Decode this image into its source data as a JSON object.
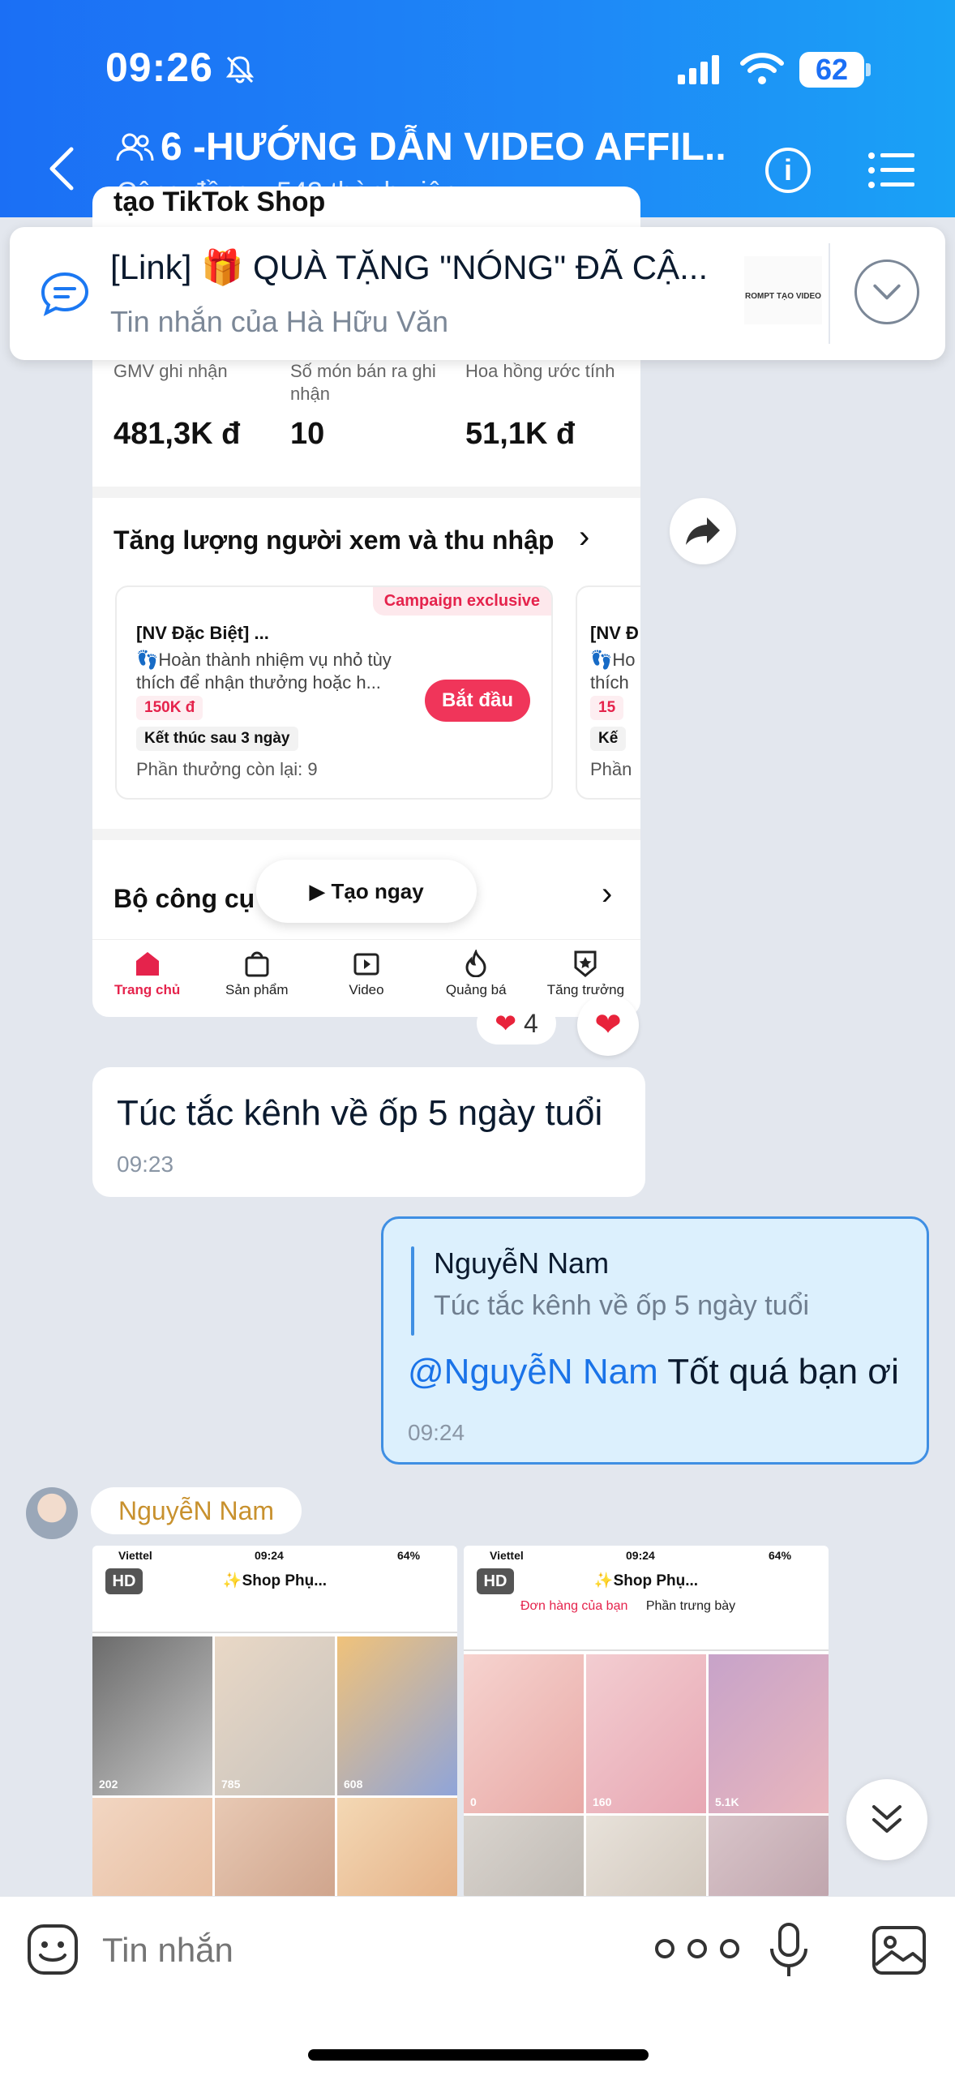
{
  "status_bar": {
    "time": "09:26",
    "battery": "62"
  },
  "header": {
    "title": "6 -HƯỚNG DẪN VIDEO AFFIL...",
    "subtitle": "Cộng đồng • 543 thành viên"
  },
  "pinned": {
    "title": "[Link] 🎁 QUÀ TẶNG \"NÓNG\" ĐÃ CẬ...",
    "from": "Tin nhắn của Hà Hữu Văn",
    "thumb_label": "ROMPT TẠO VIDEO"
  },
  "shop_screenshot": {
    "top_text": "tạo TikTok Shop",
    "stats": [
      {
        "label": "GMV ghi nhận",
        "value": "481,3K đ"
      },
      {
        "label": "Số món bán ra ghi nhận",
        "value": "10"
      },
      {
        "label": "Hoa hồng ước tính",
        "value": "51,1K đ"
      }
    ],
    "section_title": "Tăng lượng người xem và thu nhập",
    "task": {
      "badge": "Campaign exclusive",
      "title": "[NV Đặc Biệt] ...",
      "desc": "👣Hoàn thành nhiệm vụ nhỏ tùy thích để nhận thưởng hoặc h...",
      "reward": "150K đ",
      "ends": "Kết thúc sau 3 ngày",
      "remaining": "Phần thưởng còn lại: 9",
      "start": "Bắt đầu"
    },
    "task2": {
      "title": "[NV Đ",
      "desc": "👣Ho thích",
      "reward": "15",
      "ends": "Kế",
      "remaining": "Phần"
    },
    "tools_title": "Bộ công cụ",
    "create_button": "Tạo ngay",
    "nav": [
      "Trang chủ",
      "Sản phẩm",
      "Video",
      "Quảng bá",
      "Tăng trưởng"
    ]
  },
  "reactions": {
    "count": "4"
  },
  "messages": {
    "incoming": {
      "text": "Túc tắc kênh về ốp 5 ngày tuổi",
      "time": "09:23"
    },
    "outgoing": {
      "quote_name": "NguyễN Nam",
      "quote_text": "Túc tắc kênh về ốp 5 ngày tuổi",
      "mention": "@NguyễN Nam",
      "text": " Tốt quá bạn ơi",
      "time": "09:24"
    },
    "photo_sender": "NguyễN Nam"
  },
  "photos": [
    {
      "carrier": "Viettel",
      "time": "09:24",
      "battery": "64%",
      "hd": "HD",
      "shop": "✨Shop Phụ...",
      "counts": [
        "202",
        "785",
        "608"
      ]
    },
    {
      "carrier": "Viettel",
      "time": "09:24",
      "battery": "64%",
      "hd": "HD",
      "shop": "✨Shop Phụ...",
      "link1": "Đơn hàng của bạn",
      "link2": "Phần trưng bày",
      "counts": [
        "0",
        "160",
        "5.1K"
      ]
    }
  ],
  "input": {
    "placeholder": "Tin nhắn"
  },
  "colors": {
    "header_blue": "#1b6ff5",
    "accent_red": "#f0355a",
    "mention_blue": "#1a73e8",
    "sender_gold": "#c8912e"
  }
}
